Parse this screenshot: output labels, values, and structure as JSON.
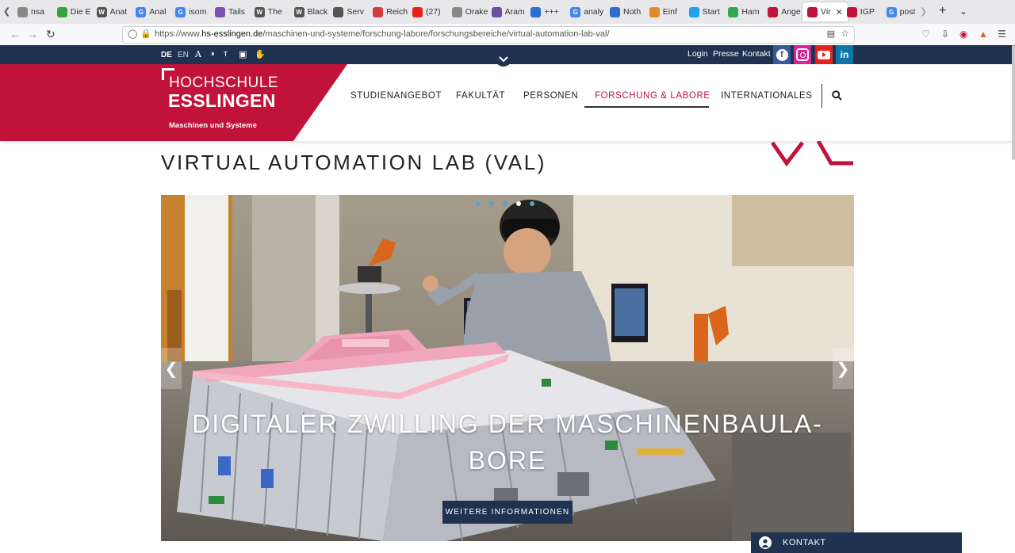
{
  "browser": {
    "tabs": [
      {
        "label": "nsa",
        "color": "#888888"
      },
      {
        "label": "Die E",
        "color": "#3aa33a"
      },
      {
        "label": "Anat",
        "color": "#555555",
        "glyph": "W"
      },
      {
        "label": "Anal",
        "color": "#4285f4",
        "glyph": "G"
      },
      {
        "label": "isom",
        "color": "#4285f4",
        "glyph": "G"
      },
      {
        "label": "Tails",
        "color": "#7a4fb0"
      },
      {
        "label": "The",
        "color": "#555555",
        "glyph": "W"
      },
      {
        "label": "Black",
        "color": "#555555",
        "glyph": "W"
      },
      {
        "label": "Serv",
        "color": "#555555"
      },
      {
        "label": "Reich",
        "color": "#d63a3a"
      },
      {
        "label": "(27)",
        "color": "#e62117"
      },
      {
        "label": "Orakeln",
        "color": "#888888"
      },
      {
        "label": "Aram",
        "color": "#6a4fa0"
      },
      {
        "label": "+++",
        "color": "#2a6fd0"
      },
      {
        "label": "analy",
        "color": "#4285f4",
        "glyph": "G"
      },
      {
        "label": "Noth",
        "color": "#2a6fd0"
      },
      {
        "label": "Einf",
        "color": "#e08a2a"
      },
      {
        "label": "Start",
        "color": "#1da1f2"
      },
      {
        "label": "Ham",
        "color": "#34a853"
      },
      {
        "label": "Ange",
        "color": "#c0123a"
      },
      {
        "label": "Vir",
        "color": "#c0123a"
      },
      {
        "label": "IGP",
        "color": "#c0123a"
      },
      {
        "label": "post",
        "color": "#4285f4",
        "glyph": "G"
      }
    ],
    "active_tab_index": 20,
    "url_prefix": "https://www.",
    "url_domain": "hs-esslingen.de",
    "url_path": "/maschinen-und-systeme/forschung-labore/forschungsbereiche/virtual-automation-lab-val/"
  },
  "topbar": {
    "lang_de": "DE",
    "lang_en": "EN",
    "login": "Login",
    "presse": "Presse",
    "kontakt": "Kontakt",
    "social": {
      "facebook_color": "#3b5998",
      "instagram_color": "#d6249f",
      "youtube_color": "#e62117",
      "linkedin_color": "#0e76a8"
    }
  },
  "header": {
    "logo_line1": "HOCHSCHULE",
    "logo_line2": "ESSLINGEN",
    "logo_sub": "Maschinen und Systeme",
    "brand_color": "#c0123a",
    "nav": [
      {
        "label": "STUDIENANGEBOT"
      },
      {
        "label": "FAKULTÄT"
      },
      {
        "label": "PERSONEN"
      },
      {
        "label": "FORSCHUNG & LABORE",
        "active": true
      },
      {
        "label": "INTERNATIONALES"
      }
    ]
  },
  "page": {
    "title": "VIRTUAL AUTOMATION LAB (VAL)",
    "slider": {
      "slide_count": 5,
      "active_slide": 3,
      "headline_line1": "DIGITALER ZWILLING DER MASCHINENBAULA-",
      "headline_line2": "BORE",
      "button": "WEITERE INFORMATIONEN"
    },
    "kontakt_widget": "KONTAKT"
  },
  "colors": {
    "navy": "#1f3350",
    "accent_red": "#c0123a"
  }
}
